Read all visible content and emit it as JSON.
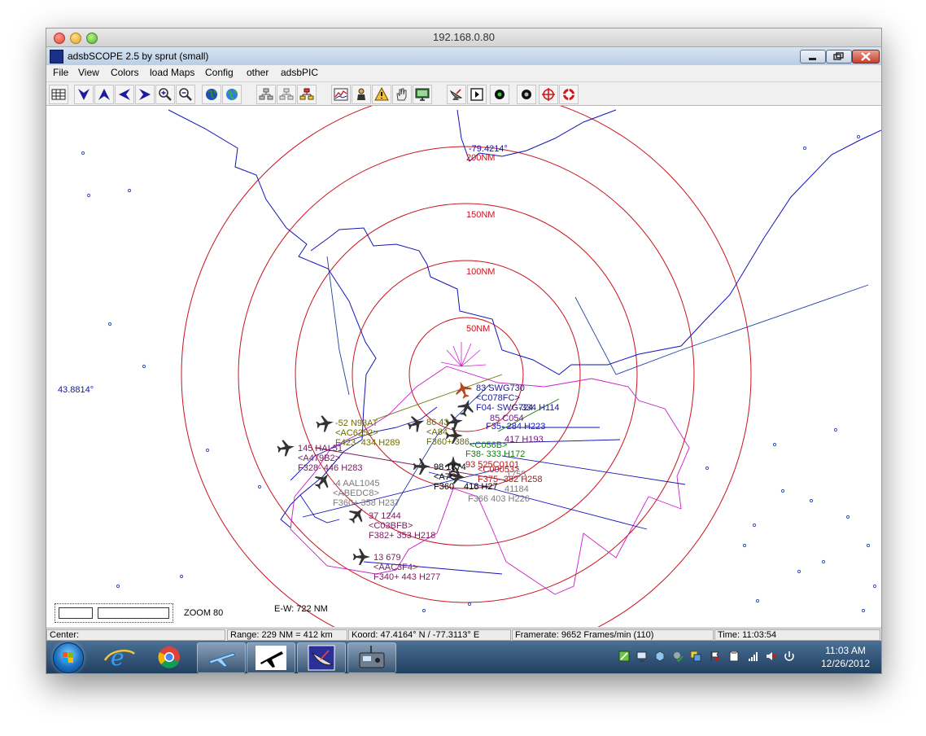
{
  "outer_window": {
    "title": "192.168.0.80"
  },
  "app_window": {
    "title": "adsbSCOPE 2.5   by sprut  (small)"
  },
  "menu": [
    "File",
    "View",
    "Colors",
    "load Maps",
    "Config",
    "other",
    "adsbPIC"
  ],
  "toolbar": {
    "icons": [
      "table-icon",
      "arrow-down-icon",
      "arrow-up-icon",
      "arrow-left-icon",
      "arrow-right-icon",
      "zoom-in-icon",
      "zoom-out-icon",
      "globe-icon",
      "globe-color-icon",
      "tree-icon",
      "tree-gray-icon",
      "tree-color-icon",
      "chart-icon",
      "person-icon",
      "warning-icon",
      "hand-icon",
      "monitor-icon",
      "dish-icon",
      "play-icon",
      "dot-green-icon",
      "dot-black-icon",
      "crosshair-icon",
      "target-icon"
    ]
  },
  "map": {
    "range_labels": [
      "50NM",
      "100NM",
      "150NM",
      "200NM"
    ],
    "longitude_label": "-79.4214°",
    "latitude_label": "43.8814°",
    "zoom_label": "ZOOM 80",
    "ew_label": "E-W: 722 NM",
    "aircraft": [
      {
        "lines": [
          "83  SWG730",
          "<C078FC>",
          "F04- SWG724"
        ],
        "color": "#1a1a9c"
      },
      {
        "lines": [
          "85  C054"
        ],
        "color": "#6b1a7a"
      },
      {
        "lines": [
          "-334  H114"
        ],
        "color": "#1a1a9c"
      },
      {
        "lines": [
          "F35- 284  H223"
        ],
        "color": "#1a1a9c"
      },
      {
        "lines": [
          "86  43",
          "<A84",
          "F360+  386"
        ],
        "color": "#6b6b00"
      },
      {
        "lines": [
          "<C056B>"
        ],
        "color": "#157a15"
      },
      {
        "lines": [
          "F38- 333  H172"
        ],
        "color": "#157a15"
      },
      {
        "lines": [
          "93  525C0101"
        ],
        "color": "#b0171a"
      },
      {
        "lines": [
          "417  H193"
        ],
        "color": "#6b1a7a"
      },
      {
        "lines": [
          "-52  N93AT",
          "<AC6252>",
          "F423-  434  H289"
        ],
        "color": "#6b6b00"
      },
      {
        "lines": [
          "145  HAL51",
          "<A479B2>",
          "F328-  446  H283"
        ],
        "color": "#7a1a5c"
      },
      {
        "lines": [
          "-4  AAL1045",
          "<ABEDC8>",
          "F360+  358  H237"
        ],
        "color": "#7a7a7a"
      },
      {
        "lines": [
          "98  1874",
          "<A7C",
          "F360"
        ],
        "color": "#000000"
      },
      {
        "lines": [
          "416  H27"
        ],
        "color": "#000000"
      },
      {
        "lines": [
          "<C00053>",
          "F375-  382  H258"
        ],
        "color": "#b0171a"
      },
      {
        "lines": [
          "1755"
        ],
        "color": "#7a7a7a"
      },
      {
        "lines": [
          "41184",
          "F366  403  H226"
        ],
        "color": "#7a7a7a"
      },
      {
        "lines": [
          "37  1244",
          "<C03BFB>",
          "F382+  353  H218"
        ],
        "color": "#7a1a5c"
      },
      {
        "lines": [
          "13  679",
          "<AAC3F4>",
          "F340+  443  H277"
        ],
        "color": "#7a1a5c"
      }
    ]
  },
  "status": {
    "center": "Center:",
    "range": "Range: 229 NM = 412 km",
    "koord": "Koord: 47.4164° N / -77.3113° E",
    "framerate": "Framerate:  9652 Frames/min (110)",
    "time": "Time: 11:03:54"
  },
  "taskbar": {
    "apps": [
      "ie-icon",
      "chrome-icon",
      "plane-outline-icon",
      "plane-black-icon",
      "adsbscope-icon",
      "radio-icon"
    ],
    "clock_time": "11:03 AM",
    "clock_date": "12/26/2012"
  }
}
